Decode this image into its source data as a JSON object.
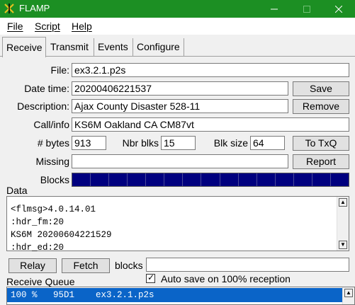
{
  "window": {
    "title": "FLAMP"
  },
  "menu": {
    "file": "File",
    "script": "Script",
    "help": "Help"
  },
  "tabs": [
    "Receive",
    "Transmit",
    "Events",
    "Configure"
  ],
  "receive": {
    "file_label": "File:",
    "file_value": "ex3.2.1.p2s",
    "datetime_label": "Date time:",
    "datetime_value": "20200406221537",
    "save_button": "Save",
    "description_label": "Description:",
    "description_value": "Ajax County Disaster 528-11",
    "remove_button": "Remove",
    "callinfo_label": "Call/info",
    "callinfo_value": "KS6M Oakland CA CM87vt",
    "bytes_label": "# bytes",
    "bytes_value": "913",
    "nbrblks_label": "Nbr blks",
    "nbrblks_value": "15",
    "blksize_label": "Blk size",
    "blksize_value": "64",
    "totxq_button": "To TxQ",
    "missing_label": "Missing",
    "missing_value": "",
    "report_button": "Report",
    "blocks_label": "Blocks",
    "blocks_count": 15,
    "blocks_color": "#00007f",
    "data_label": "Data",
    "data_lines": [
      "<flmsg>4.0.14.01",
      ":hdr_fm:20",
      "KS6M 20200604221529",
      ":hdr_ed:20"
    ],
    "relay_button": "Relay",
    "fetch_button": "Fetch",
    "blocks_field_label": "blocks",
    "blocks_field_value": "",
    "autosave_label": "Auto save on 100% reception",
    "autosave_checked": true,
    "queue_label": "Receive Queue",
    "queue": [
      {
        "percent": "100 %",
        "id": "95D1",
        "file": "ex3.2.1.p2s"
      }
    ]
  },
  "colors": {
    "titlebar": "#1c8f23",
    "selection": "#0a64c8"
  }
}
